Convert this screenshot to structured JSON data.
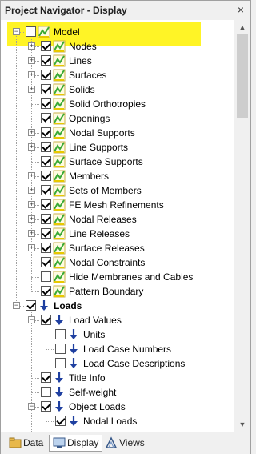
{
  "window": {
    "title": "Project Navigator - Display",
    "close_glyph": "×"
  },
  "tree": [
    {
      "label": "Model",
      "level": 0,
      "checked": false,
      "expander": "-",
      "icon": "model-check-icon",
      "bold": false,
      "highlight": true
    },
    {
      "label": "Nodes",
      "level": 1,
      "checked": true,
      "expander": "+",
      "icon": "model-check-icon"
    },
    {
      "label": "Lines",
      "level": 1,
      "checked": true,
      "expander": "+",
      "icon": "model-check-icon"
    },
    {
      "label": "Surfaces",
      "level": 1,
      "checked": true,
      "expander": "+",
      "icon": "model-check-icon"
    },
    {
      "label": "Solids",
      "level": 1,
      "checked": true,
      "expander": "+",
      "icon": "model-check-icon"
    },
    {
      "label": "Solid Orthotropies",
      "level": 1,
      "checked": true,
      "expander": "",
      "icon": "model-check-icon"
    },
    {
      "label": "Openings",
      "level": 1,
      "checked": true,
      "expander": "",
      "icon": "model-check-icon"
    },
    {
      "label": "Nodal Supports",
      "level": 1,
      "checked": true,
      "expander": "+",
      "icon": "model-check-icon"
    },
    {
      "label": "Line Supports",
      "level": 1,
      "checked": true,
      "expander": "+",
      "icon": "model-check-icon"
    },
    {
      "label": "Surface Supports",
      "level": 1,
      "checked": true,
      "expander": "",
      "icon": "model-check-icon"
    },
    {
      "label": "Members",
      "level": 1,
      "checked": true,
      "expander": "+",
      "icon": "model-check-icon"
    },
    {
      "label": "Sets of Members",
      "level": 1,
      "checked": true,
      "expander": "+",
      "icon": "model-check-icon"
    },
    {
      "label": "FE Mesh Refinements",
      "level": 1,
      "checked": true,
      "expander": "+",
      "icon": "model-check-icon"
    },
    {
      "label": "Nodal Releases",
      "level": 1,
      "checked": true,
      "expander": "+",
      "icon": "model-check-icon"
    },
    {
      "label": "Line Releases",
      "level": 1,
      "checked": true,
      "expander": "+",
      "icon": "model-check-icon"
    },
    {
      "label": "Surface Releases",
      "level": 1,
      "checked": true,
      "expander": "+",
      "icon": "model-check-icon"
    },
    {
      "label": "Nodal Constraints",
      "level": 1,
      "checked": true,
      "expander": "",
      "icon": "model-check-icon"
    },
    {
      "label": "Hide Membranes and Cables",
      "level": 1,
      "checked": false,
      "expander": "",
      "icon": "model-check-icon"
    },
    {
      "label": "Pattern Boundary",
      "level": 1,
      "checked": true,
      "expander": "",
      "icon": "model-check-icon"
    },
    {
      "label": "Loads",
      "level": 0,
      "checked": true,
      "expander": "-",
      "icon": "load-arrow-icon",
      "bold": true
    },
    {
      "label": "Load Values",
      "level": 1,
      "checked": true,
      "expander": "-",
      "icon": "load-arrow-icon"
    },
    {
      "label": "Units",
      "level": 2,
      "checked": false,
      "expander": "",
      "icon": "load-arrow-icon"
    },
    {
      "label": "Load Case Numbers",
      "level": 2,
      "checked": false,
      "expander": "",
      "icon": "load-arrow-icon"
    },
    {
      "label": "Load Case Descriptions",
      "level": 2,
      "checked": false,
      "expander": "",
      "icon": "load-arrow-icon"
    },
    {
      "label": "Title Info",
      "level": 1,
      "checked": true,
      "expander": "",
      "icon": "load-arrow-icon"
    },
    {
      "label": "Self-weight",
      "level": 1,
      "checked": false,
      "expander": "",
      "icon": "load-arrow-icon"
    },
    {
      "label": "Object Loads",
      "level": 1,
      "checked": true,
      "expander": "-",
      "icon": "load-arrow-icon"
    },
    {
      "label": "Nodal Loads",
      "level": 2,
      "checked": true,
      "expander": "",
      "icon": "load-arrow-icon",
      "partial": true
    }
  ],
  "tabs": [
    {
      "label": "Data",
      "icon": "data-folder-icon",
      "active": false
    },
    {
      "label": "Display",
      "icon": "display-icon",
      "active": true
    },
    {
      "label": "Views",
      "icon": "views-icon",
      "active": false
    }
  ],
  "scrollbar": {
    "up_glyph": "▲",
    "down_glyph": "▼"
  },
  "colors": {
    "highlight": "#fff200",
    "model_icon_green": "#3aaa35",
    "model_icon_yellow": "#e8c800",
    "load_icon_blue": "#1e3fa0"
  }
}
